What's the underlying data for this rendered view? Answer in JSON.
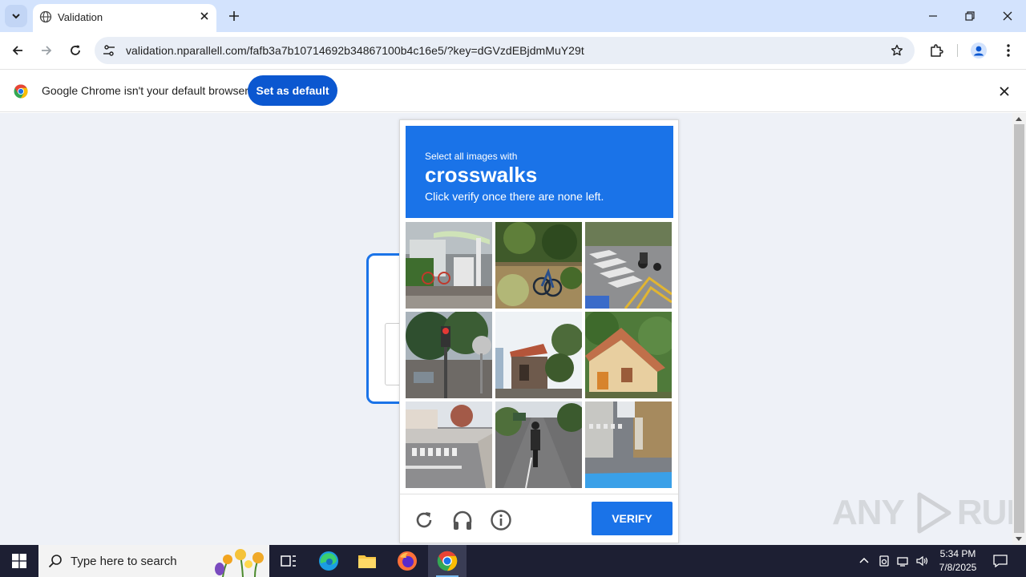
{
  "browser": {
    "tab": {
      "title": "Validation"
    },
    "address": "validation.nparallell.com/fafb3a7b10714692b34867100b4c16e5/?key=dGVzdEBjdmMuY29t",
    "infobar": {
      "message": "Google Chrome isn't your default browser",
      "button": "Set as default"
    }
  },
  "captcha": {
    "instruction": "Select all images with",
    "target": "crosswalks",
    "hint": "Click verify once there are none left.",
    "verify_label": "VERIFY",
    "tiles": [
      {
        "subject": "bike share station"
      },
      {
        "subject": "bicycle among shrubs"
      },
      {
        "subject": "motorcycle on crosswalk"
      },
      {
        "subject": "traffic light"
      },
      {
        "subject": "house with trees"
      },
      {
        "subject": "house with orange roof"
      },
      {
        "subject": "street crosswalk"
      },
      {
        "subject": "motorcycle on road"
      },
      {
        "subject": "narrow street crosswalk"
      }
    ],
    "accent_color": "#1a73e8"
  },
  "watermark": "ANY RUN",
  "taskbar": {
    "search_placeholder": "Type here to search",
    "time": "5:34 PM",
    "date": "7/8/2025"
  }
}
